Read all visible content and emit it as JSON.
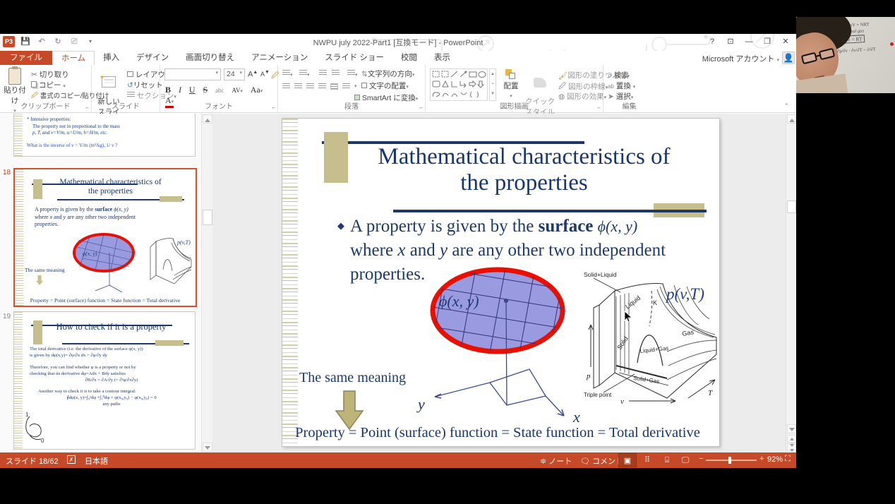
{
  "titlebar": {
    "title": "NWPU july 2022-Part1 [互換モード] - PowerPoint",
    "help": "?",
    "account_label": "Microsoft アカウント"
  },
  "tabs": {
    "file": "ファイル",
    "home": "ホーム",
    "insert": "挿入",
    "design": "デザイン",
    "transitions": "画面切り替え",
    "animations": "アニメーション",
    "slideshow": "スライド ショー",
    "review": "校閲",
    "view": "表示"
  },
  "ribbon": {
    "clipboard": {
      "label": "クリップボード",
      "paste": "貼り付け",
      "cut": "切り取り",
      "copy": "コピー",
      "format_painter": "書式のコピー/貼り付け"
    },
    "slides": {
      "label": "スライド",
      "new_slide": "新しい\nスライド",
      "layout": "レイアウト",
      "reset": "リセット",
      "section": "セクション"
    },
    "font": {
      "label": "フォント",
      "size": "24",
      "bold": "B",
      "italic": "I",
      "underline": "U",
      "strike": "S",
      "abc": "abc",
      "av": "AV",
      "aa": "Aa",
      "color": "A",
      "grow": "A",
      "shrink": "A"
    },
    "paragraph": {
      "label": "段落",
      "text_direction": "文字列の方向",
      "align_text": "文字の配置",
      "smartart": "SmartArt に変換"
    },
    "drawing": {
      "label": "図形描画",
      "arrange": "配置",
      "quick_styles": "クイック\nスタイル",
      "shape_fill": "図形の塗りつぶし",
      "shape_outline": "図形の枠線",
      "shape_effects": "図形の効果"
    },
    "editing": {
      "label": "編集",
      "find": "検索",
      "replace": "置換",
      "select": "選択"
    }
  },
  "thumbnails": {
    "slide17": {
      "lines": [
        "* Intensive properties:",
        "The property not in proportional to the mass",
        "p, T, and v=V/m, u=U/m, h=H/m, etc.",
        "What is the inverse of v = V/m   (m³/kg), 1/ v ?"
      ]
    },
    "slide18": {
      "number": "18"
    },
    "slide19": {
      "number": "19",
      "title": "How to check if it is a property",
      "lines": [
        "The total derivative (i.e. the derivative of the surface φ(x, y))",
        "is given by   dφ(x,y)= ∂φ/∂x dx + ∂φ/∂y dy",
        "Therefore, you can find whether φ is a property or not by",
        "checking that its derivative   dφ=Adx + Bdy   satisfies",
        "∂B/∂x = ∂A/∂y (= ∂²φ/∂x∂y)",
        "Another way to check it is to take a contour integral:",
        "∮dφ(x, y)=∫₀¹dφ +∫₁⁰dφ = φ(x₀,y₀) − φ(x₀,y₀) = 0",
        "any paths"
      ],
      "loop_top": "1",
      "loop_bottom": "0"
    }
  },
  "slide": {
    "title_line1": "Mathematical characteristics of",
    "title_line2": "the properties",
    "bullet": {
      "pre": "A property is given by the ",
      "bold": "surface",
      "formula": "ϕ(x, y)",
      "line2a": "where ",
      "line2x": "x",
      "line2b": " and ",
      "line2y": "y",
      "line2c": " are any other two independent",
      "line3": "properties."
    },
    "ellipse_label": "ϕ(x, y)",
    "axis_x": "x",
    "axis_y": "y",
    "same_meaning": "The same meaning",
    "bottom_line": "Property = Point (surface) function = State function = Total derivative",
    "pvt": {
      "title": "p(v,T)",
      "solid_liquid": "Solid+Liquid",
      "liquid": "Liquid",
      "k": "K",
      "gas": "Gas",
      "liquid_gas": "Liquid+Gas",
      "solid": "Solid",
      "solid_gas": "Solid+Gas",
      "triple_point": "Triple point",
      "p": "p",
      "v": "v",
      "t": "T"
    }
  },
  "statusbar": {
    "slide_counter": "スライド 18/62",
    "language": "日本語",
    "notes": "ノート",
    "comments": "コメント",
    "zoom_level": "92%"
  },
  "webcam": {
    "board_line1": "pV = NRT",
    "board_line2": "Ideal gas",
    "board_line3": "pv = RT",
    "board_line4": "∂p/∂v · ∂v/∂T − ∂/∂T"
  },
  "colors": {
    "accent": "#C64A27",
    "navy": "#17366D",
    "khaki": "#C6BE8C",
    "ellipse_fill": "#9A9AE0",
    "ellipse_border": "#E81000",
    "selection": "#D4502E"
  }
}
